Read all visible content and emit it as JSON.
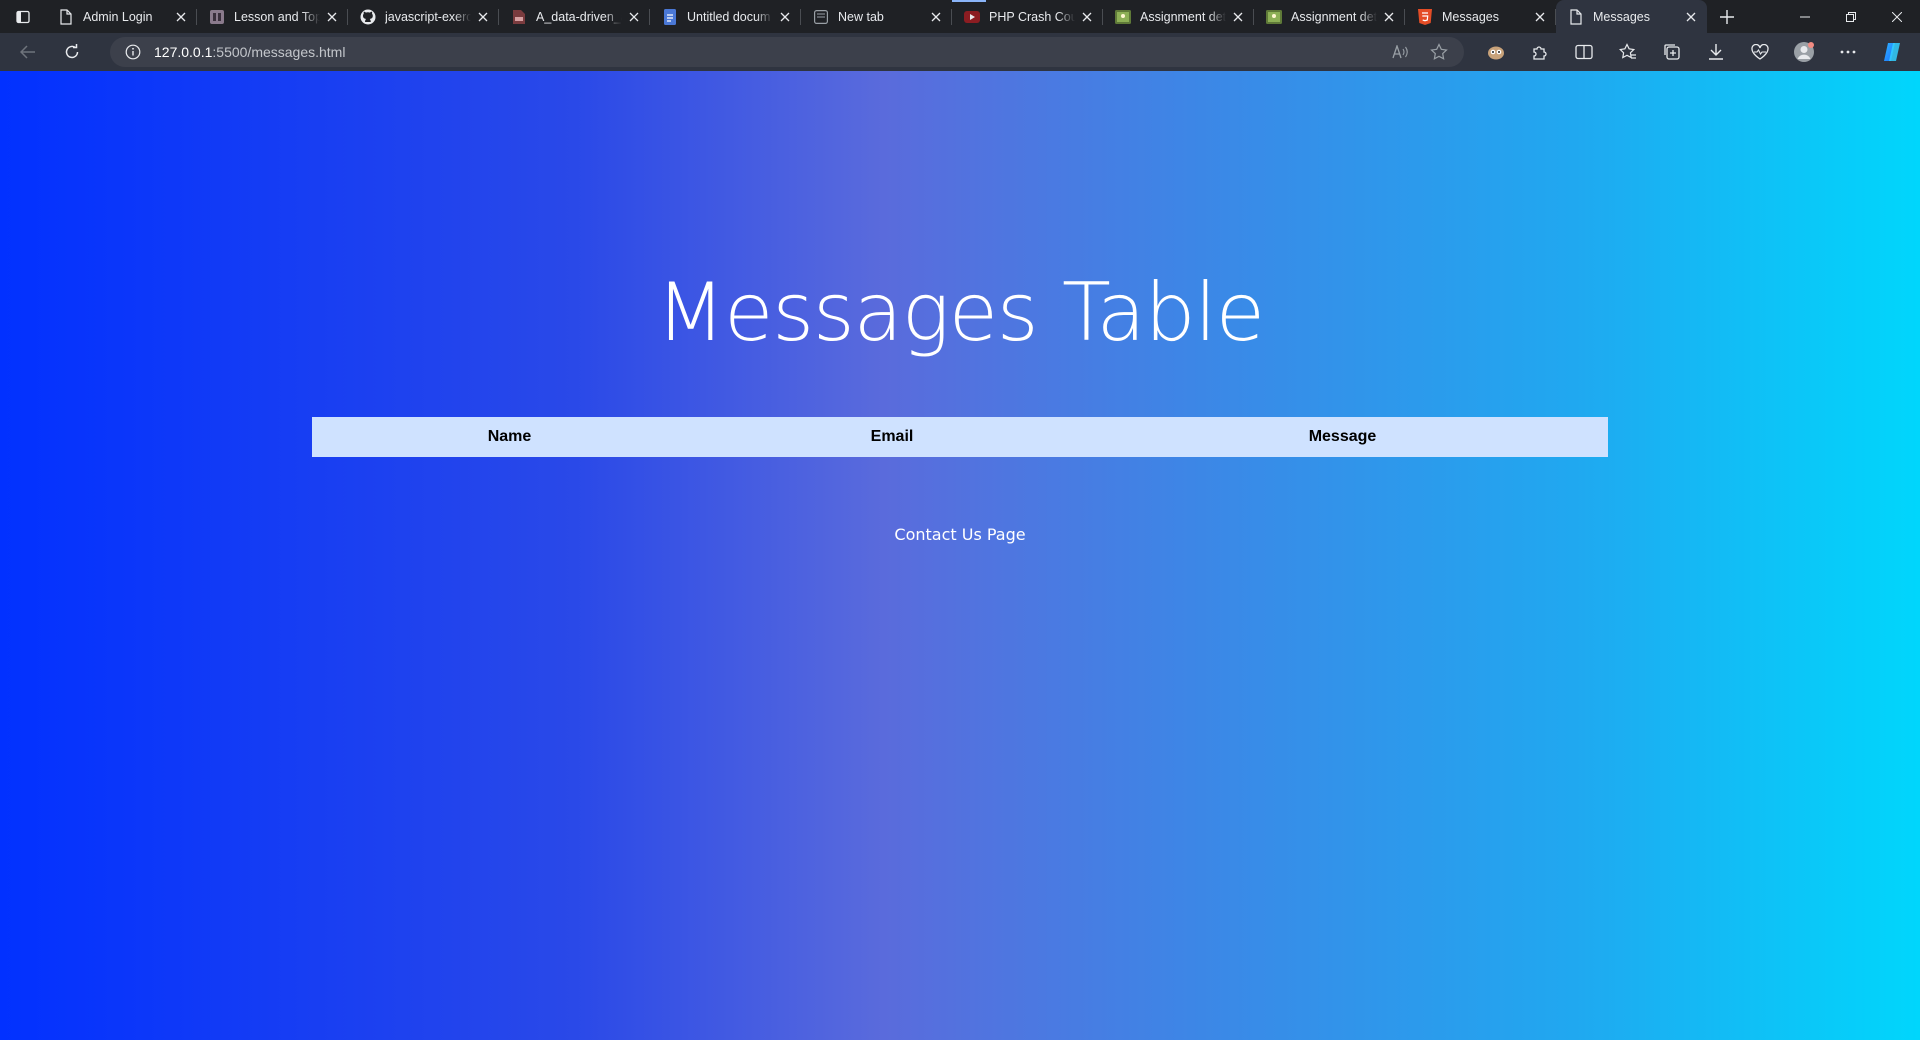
{
  "browser": {
    "tabs": [
      {
        "title": "Admin Login",
        "icon": "page-icon"
      },
      {
        "title": "Lesson and Topi",
        "icon": "lesson-icon"
      },
      {
        "title": "javascript-exerci",
        "icon": "github-icon"
      },
      {
        "title": "A_data-driven_a",
        "icon": "pdf-icon"
      },
      {
        "title": "Untitled docum",
        "icon": "docs-icon"
      },
      {
        "title": "New tab",
        "icon": "new-tab-page-icon"
      },
      {
        "title": "PHP Crash Cour",
        "icon": "youtube-icon"
      },
      {
        "title": "Assignment det",
        "icon": "classroom-icon"
      },
      {
        "title": "Assignment det",
        "icon": "classroom-icon"
      },
      {
        "title": "Messages",
        "icon": "html5-icon"
      },
      {
        "title": "Messages",
        "icon": "page-icon",
        "active": true
      }
    ],
    "url_host": "127.0.0.1",
    "url_rest": ":5500/messages.html"
  },
  "page": {
    "heading": "Messages Table",
    "table": {
      "headers": [
        "Name",
        "Email",
        "Message"
      ],
      "header_bg": "#cfe2ff"
    },
    "link_text": "Contact Us Page"
  },
  "colors": {
    "gradient_left": "#0231ff",
    "gradient_mid": "#5a6bdc",
    "gradient_right": "#00d6fc",
    "browser_frame": "#1f2125",
    "toolbar": "#2f3440"
  }
}
